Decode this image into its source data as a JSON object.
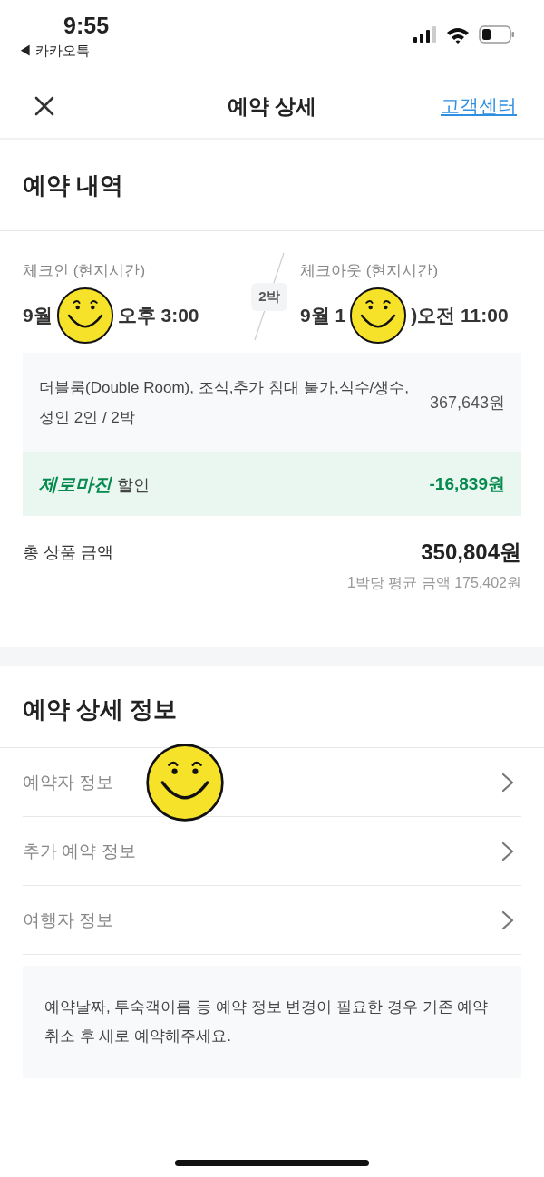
{
  "status_bar": {
    "time": "9:55",
    "back_app": "◀ 카카오톡"
  },
  "nav": {
    "title": "예약 상세",
    "link": "고객센터"
  },
  "reservation": {
    "heading": "예약 내역",
    "checkin": {
      "label": "체크인 (현지시간)",
      "date_start": "9월",
      "time": "오후 3:00"
    },
    "nights": "2박",
    "checkout": {
      "label": "체크아웃 (현지시간)",
      "date_start": "9월 1",
      "time": ")오전 11:00"
    },
    "product": {
      "description": "더블룸(Double Room), 조식,추가 침대 불가,식수/생수, 성인 2인 / 2박",
      "price": "367,643원"
    },
    "discount": {
      "brand": "제로마진",
      "label": "할인",
      "amount": "-16,839원"
    },
    "total": {
      "label": "총 상품 금액",
      "amount": "350,804원",
      "average": "1박당 평균 금액 175,402원"
    }
  },
  "details": {
    "heading": "예약 상세 정보",
    "rows": [
      {
        "label": "예약자 정보"
      },
      {
        "label": "추가 예약 정보"
      },
      {
        "label": "여행자 정보"
      }
    ],
    "notice": "예약날짜, 투숙객이름 등 예약 정보 변경이 필요한 경우 기존 예약 취소 후 새로 예약해주세요."
  }
}
